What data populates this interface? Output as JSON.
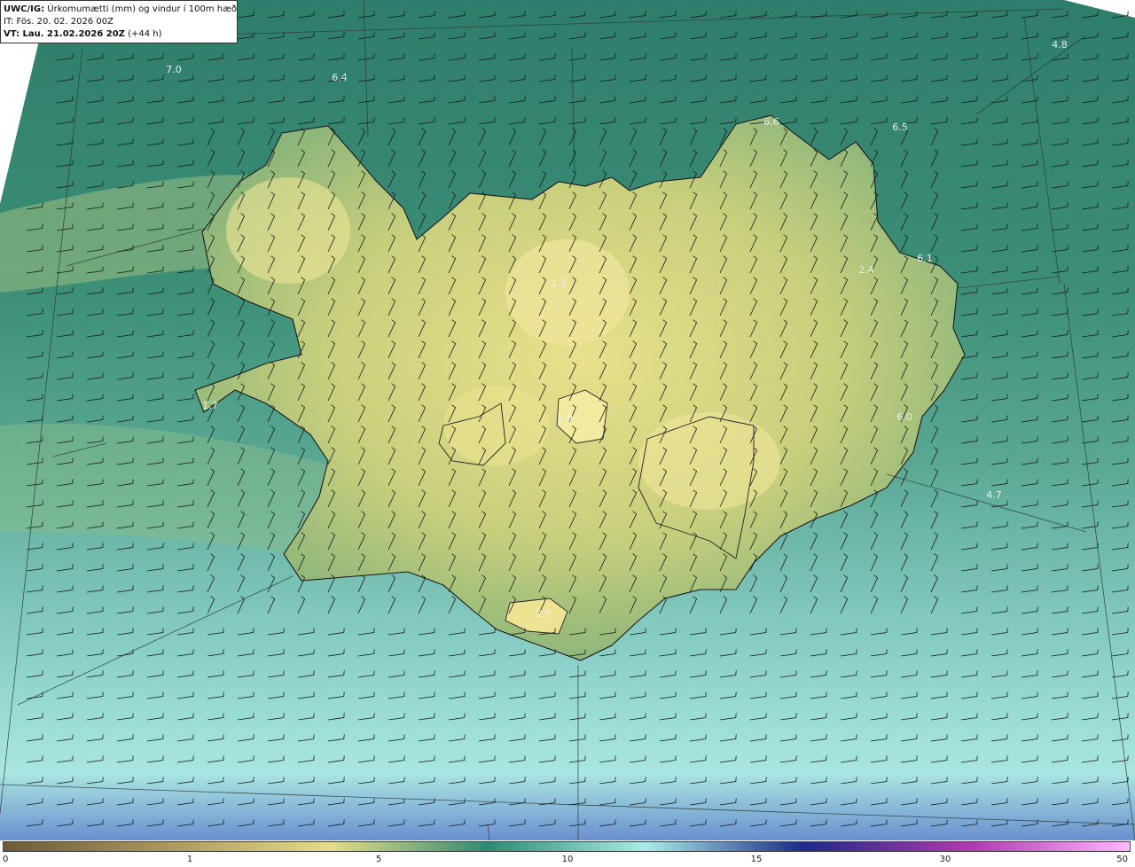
{
  "header": {
    "model": "UWC/IG:",
    "description": " Úrkomumætti (mm) og vindur í 100m hæð",
    "issue_time": "IT: Fös. 20. 02. 2026 00Z",
    "valid_prefix": "VT: Lau. 21.02.2026 20Z",
    "valid_suffix": " (+44 h)"
  },
  "map": {
    "region": "Iceland",
    "field": "precipitable water (mm)",
    "point_values": [
      {
        "label": "7.0"
      },
      {
        "label": "6.4"
      },
      {
        "label": "4.8"
      },
      {
        "label": "6.6"
      },
      {
        "label": "6.5"
      },
      {
        "label": "6.1"
      },
      {
        "label": "2.4"
      },
      {
        "label": "1.3"
      },
      {
        "label": "1.0"
      },
      {
        "label": "6.0"
      },
      {
        "label": "4.7"
      },
      {
        "label": "1.7"
      },
      {
        "label": "2.5"
      }
    ]
  },
  "colorbar": {
    "ticks": [
      "0",
      "1",
      "5",
      "10",
      "15",
      "30",
      "50"
    ],
    "colors": [
      "#6b5a3a",
      "#a8955e",
      "#e6dc8a",
      "#2f8a72",
      "#a8ece8",
      "#1c2a86",
      "#b03ab0",
      "#ffb8ff"
    ]
  }
}
